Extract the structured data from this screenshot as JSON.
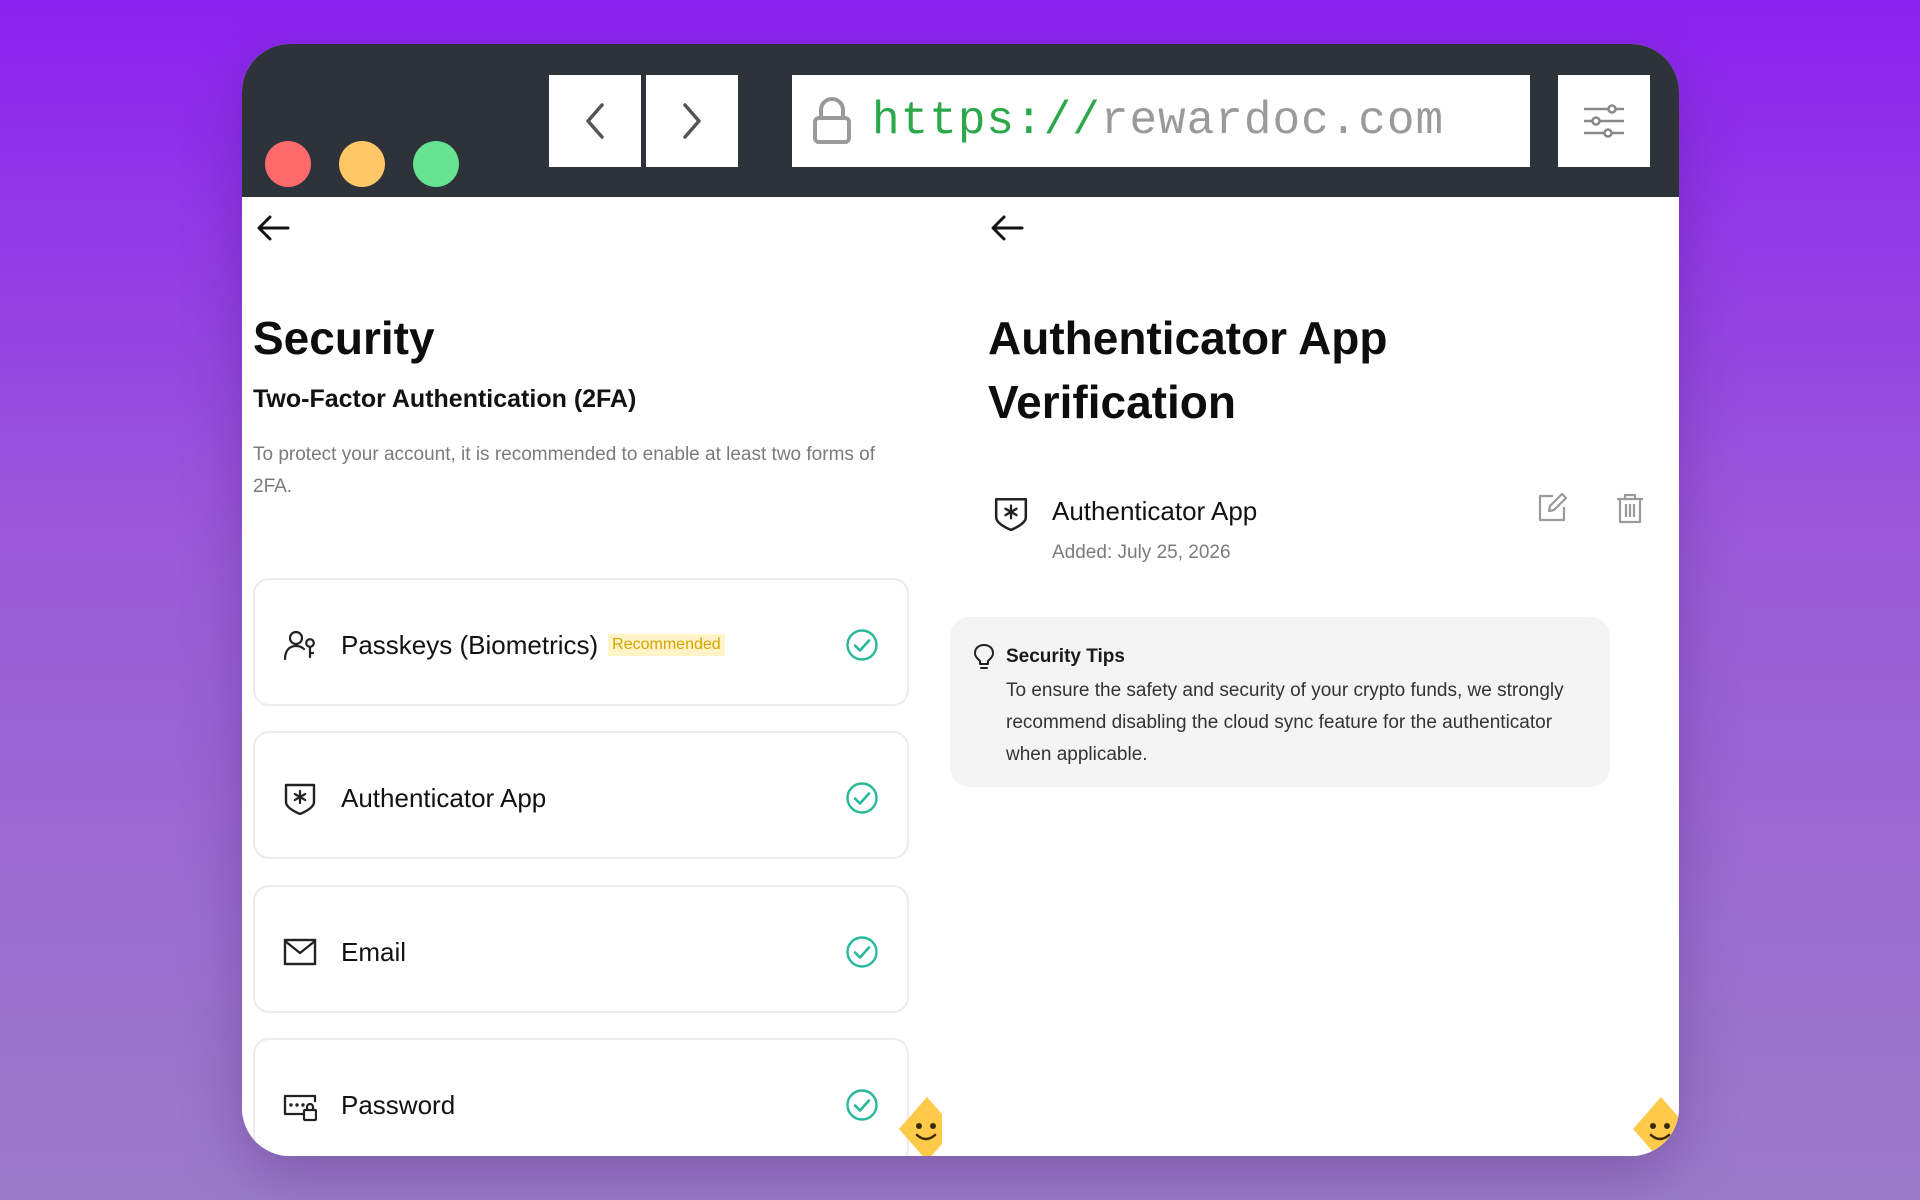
{
  "browser": {
    "url_scheme": "https://",
    "url_host": "rewardoc.com",
    "traffic_lights": {
      "close": "#ff6b6b",
      "minimize": "#ffc766",
      "maximize": "#67e394"
    },
    "icons": {
      "lock": "lock-icon",
      "back": "chevron-left-icon",
      "forward": "chevron-right-icon",
      "settings": "sliders-icon"
    }
  },
  "security": {
    "title": "Security",
    "section_title": "Two-Factor Authentication (2FA)",
    "section_desc": "To protect your account, it is recommended to enable at least two forms of 2FA.",
    "methods": [
      {
        "label": "Passkeys (Biometrics)",
        "badge": "Recommended",
        "icon": "passkey-icon",
        "enabled": true
      },
      {
        "label": "Authenticator App",
        "icon": "authenticator-shield-icon",
        "enabled": true
      },
      {
        "label": "Email",
        "icon": "mail-icon",
        "enabled": true
      },
      {
        "label": "Password",
        "icon": "password-icon",
        "enabled": true
      }
    ]
  },
  "authenticator": {
    "title": "Authenticator App Verification",
    "app_name": "Authenticator App",
    "added": "Added: July 25, 2026",
    "tips_title": "Security Tips",
    "tips_text": "To ensure the safety and security of your crypto funds, we strongly recommend disabling the cloud sync feature for the authenticator when applicable."
  },
  "colors": {
    "check": "#27b99a",
    "badge_bg": "#fff4c8",
    "badge_text": "#d7a300",
    "titlebar": "#2e3339"
  }
}
